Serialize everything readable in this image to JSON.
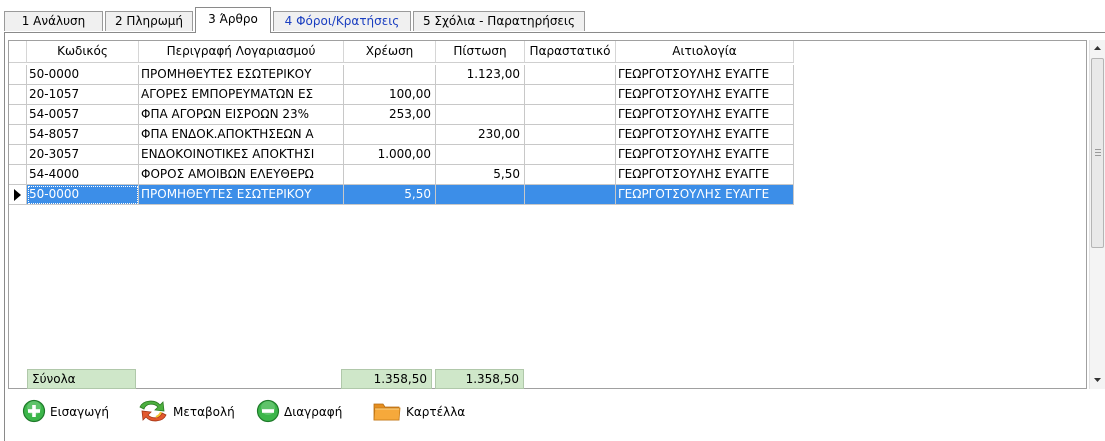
{
  "tabs": [
    {
      "label": "1 Ανάλυση"
    },
    {
      "label": "2 Πληρωμή"
    },
    {
      "label": "3 Άρθρο"
    },
    {
      "label": "4 Φόροι/Κρατήσεις"
    },
    {
      "label": "5 Σχόλια - Παρατηρήσεις"
    }
  ],
  "active_tab": "3 Άρθρο",
  "grid": {
    "headers": {
      "code": "Κωδικός",
      "description": "Περιγραφή Λογαριασμού",
      "debit": "Χρέωση",
      "credit": "Πίστωση",
      "document": "Παραστατικό",
      "justification": "Αιτιολογία"
    },
    "rows": [
      {
        "code": "50-0000",
        "description": "ΠΡΟΜΗΘΕΥΤΕΣ ΕΣΩΤΕΡΙΚΟΥ",
        "debit": "",
        "credit": "1.123,00",
        "document": "",
        "justification": "ΓΕΩΡΓΟΤΣΟΥΛΗΣ ΕΥΑΓΓΕ"
      },
      {
        "code": "20-1057",
        "description": "ΑΓΟΡΕΣ ΕΜΠΟΡΕΥΜΑΤΩΝ ΕΣ",
        "debit": "100,00",
        "credit": "",
        "document": "",
        "justification": "ΓΕΩΡΓΟΤΣΟΥΛΗΣ ΕΥΑΓΓΕ"
      },
      {
        "code": "54-0057",
        "description": "ΦΠΑ ΑΓΟΡΩΝ ΕΙΣΡΟΩΝ 23%",
        "debit": "253,00",
        "credit": "",
        "document": "",
        "justification": "ΓΕΩΡΓΟΤΣΟΥΛΗΣ ΕΥΑΓΓΕ"
      },
      {
        "code": "54-8057",
        "description": "ΦΠΑ ΕΝΔΟΚ.ΑΠΟΚΤΗΣΕΩΝ Α",
        "debit": "",
        "credit": "230,00",
        "document": "",
        "justification": "ΓΕΩΡΓΟΤΣΟΥΛΗΣ ΕΥΑΓΓΕ"
      },
      {
        "code": "20-3057",
        "description": "ΕΝΔΟΚΟΙΝΟΤΙΚΕΣ ΑΠΟΚΤΗΣΙ",
        "debit": "1.000,00",
        "credit": "",
        "document": "",
        "justification": "ΓΕΩΡΓΟΤΣΟΥΛΗΣ ΕΥΑΓΓΕ"
      },
      {
        "code": "54-4000",
        "description": "ΦΟΡΟΣ ΑΜΟΙΒΩΝ ΕΛΕΥΘΕΡΩ",
        "debit": "",
        "credit": "5,50",
        "document": "",
        "justification": "ΓΕΩΡΓΟΤΣΟΥΛΗΣ ΕΥΑΓΓΕ"
      },
      {
        "code": "50-0000",
        "description": "ΠΡΟΜΗΘΕΥΤΕΣ ΕΣΩΤΕΡΙΚΟΥ",
        "debit": "5,50",
        "credit": "",
        "document": "",
        "justification": "ΓΕΩΡΓΟΤΣΟΥΛΗΣ ΕΥΑΓΓΕ"
      }
    ],
    "selected_row_index": 6,
    "totals": {
      "label": "Σύνολα",
      "debit": "1.358,50",
      "credit": "1.358,50"
    }
  },
  "toolbar": {
    "insert_label": "Εισαγωγή",
    "edit_label": "Μεταβολή",
    "delete_label": "Διαγραφή",
    "card_label": "Καρτέλλα"
  },
  "icons": {
    "insert": "plus-circle-icon",
    "edit": "refresh-arrows-icon",
    "delete": "minus-circle-icon",
    "card": "folder-icon"
  },
  "colors": {
    "selection": "#3c8ee8",
    "totals_bg": "#cfe7c9",
    "insert_green": "#3cb64a",
    "folder_orange": "#f6a93b"
  }
}
